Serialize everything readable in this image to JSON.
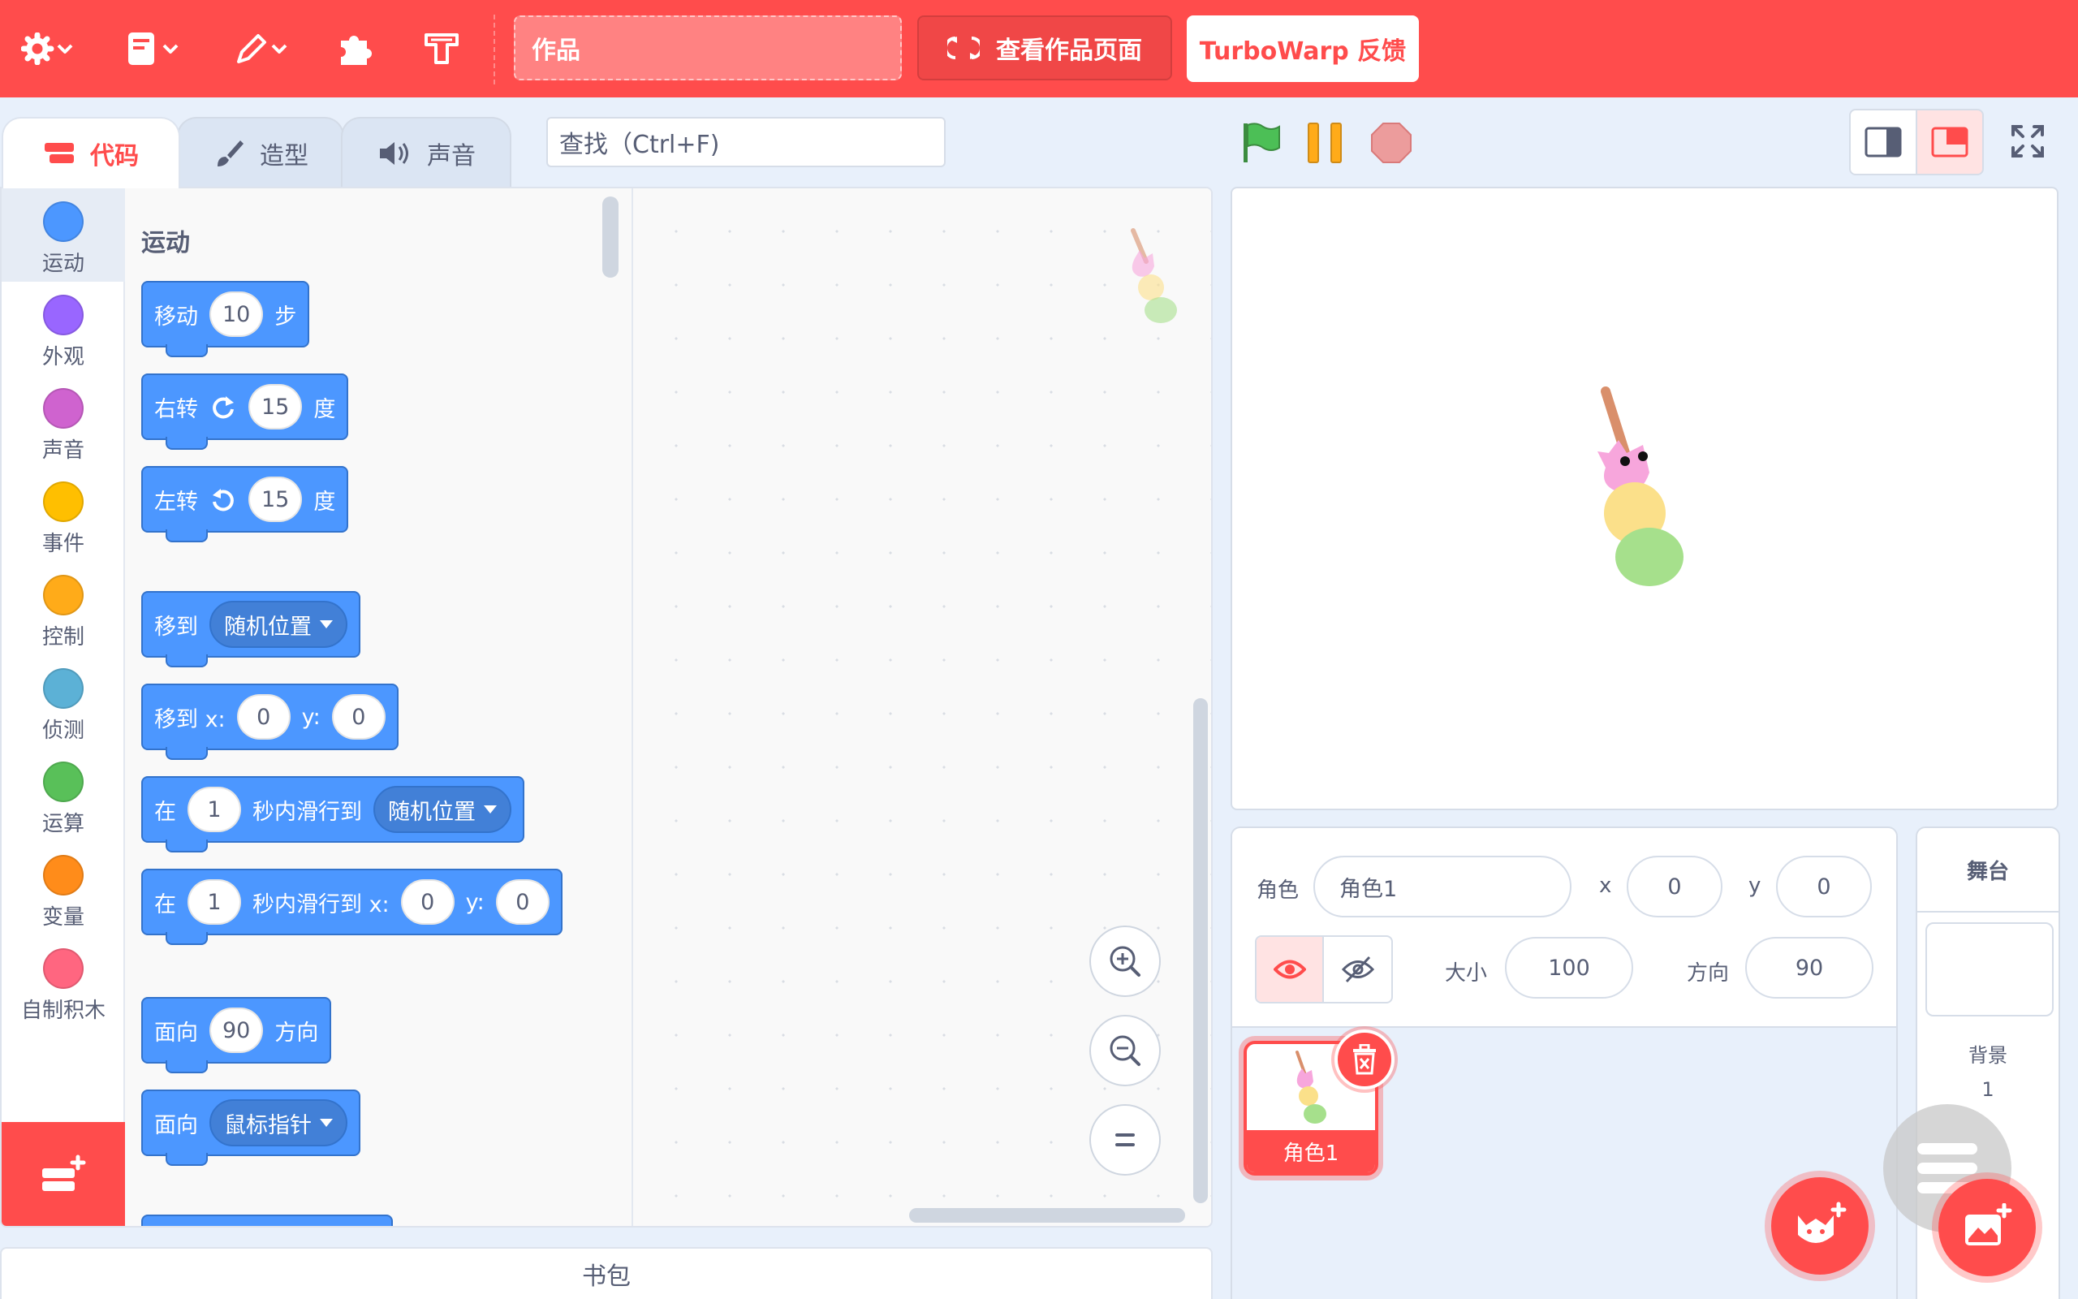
{
  "menubar": {
    "project_title": "作品",
    "see_project_label": "查看作品页面",
    "feedback_label": "TurboWarp 反馈"
  },
  "tabs": [
    {
      "label": "代码"
    },
    {
      "label": "造型"
    },
    {
      "label": "声音"
    }
  ],
  "find_placeholder": "查找（Ctrl+F)",
  "categories": [
    {
      "label": "运动",
      "color": "#4c97ff"
    },
    {
      "label": "外观",
      "color": "#9966ff"
    },
    {
      "label": "声音",
      "color": "#cf63cf"
    },
    {
      "label": "事件",
      "color": "#ffbf00"
    },
    {
      "label": "控制",
      "color": "#ffab19"
    },
    {
      "label": "侦测",
      "color": "#5cb1d6"
    },
    {
      "label": "运算",
      "color": "#59c059"
    },
    {
      "label": "变量",
      "color": "#ff8c1a"
    },
    {
      "label": "自制积木",
      "color": "#ff6680"
    }
  ],
  "flyout": {
    "section_label": "运动",
    "blocks": {
      "move": {
        "text": "移动",
        "value": "10",
        "unit": "步"
      },
      "turn_right": {
        "text": "右转",
        "value": "15",
        "unit": "度"
      },
      "turn_left": {
        "text": "左转",
        "value": "15",
        "unit": "度"
      },
      "goto": {
        "text": "移到",
        "option": "随机位置"
      },
      "goto_xy": {
        "text": "移到 x:",
        "x": "0",
        "ylabel": "y:",
        "y": "0"
      },
      "glide": {
        "text1": "在",
        "secs": "1",
        "text2": "秒内滑行到",
        "option": "随机位置"
      },
      "glide_xy": {
        "text1": "在",
        "secs": "1",
        "text2": "秒内滑行到 x:",
        "x": "0",
        "ylabel": "y:",
        "y": "0"
      },
      "point_dir": {
        "text1": "面向",
        "value": "90",
        "text2": "方向"
      },
      "point_towards": {
        "text": "面向",
        "option": "鼠标指针"
      }
    }
  },
  "backpack_label": "书包",
  "sprite_info": {
    "sprite_label": "角色",
    "sprite_name": "角色1",
    "x_label": "x",
    "x_value": "0",
    "y_label": "y",
    "y_value": "0",
    "size_label": "大小",
    "size_value": "100",
    "direction_label": "方向",
    "direction_value": "90"
  },
  "sprite_list": [
    {
      "name": "角色1"
    }
  ],
  "stage_panel": {
    "header": "舞台",
    "backdrops_label": "背景",
    "backdrops_count": "1"
  },
  "colors": {
    "brand": "#ff4c4c",
    "motion": "#4c97ff",
    "workspace_bg": "#f9f9f9"
  }
}
